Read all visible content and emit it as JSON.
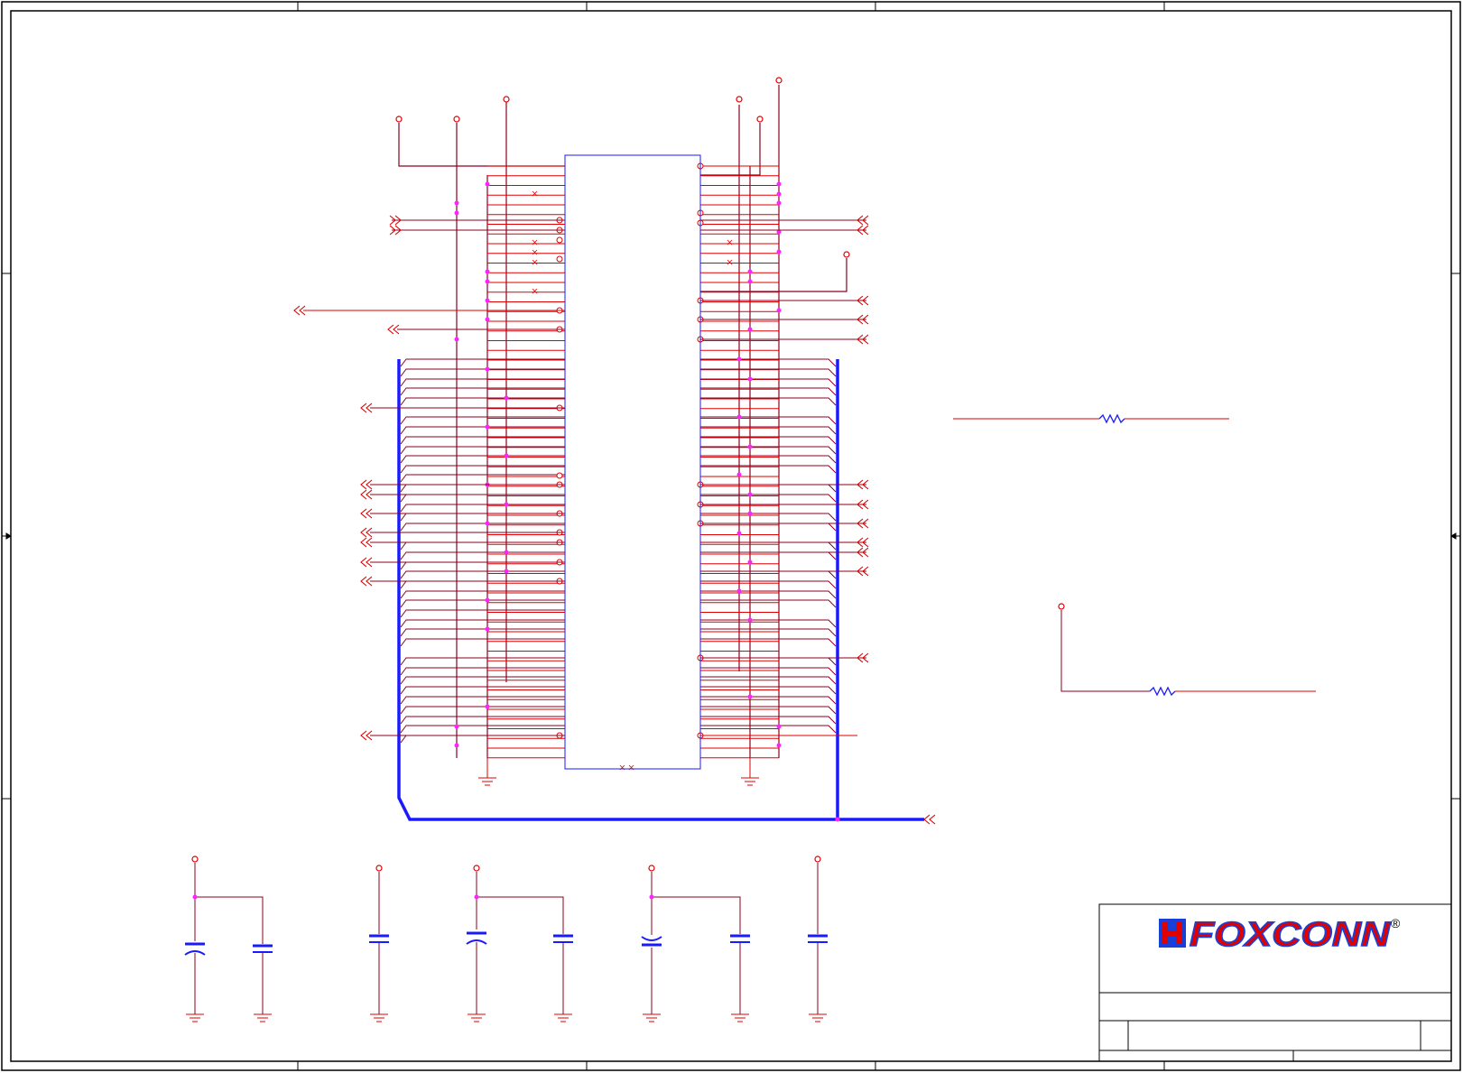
{
  "title_block": {
    "company_logo_text": "FOXCONN",
    "registered_mark": "®"
  },
  "colors": {
    "net": "#e00000",
    "bus_net": "#8b0020",
    "bus": "#1a1aff",
    "junction": "#ff22ff",
    "component_outline": "#1a1aff",
    "frame": "#000000",
    "logo_red": "#e00000",
    "logo_blue": "#1a3fd8"
  },
  "icons": {
    "power_port": "open-circle-terminal",
    "off_page_connector": "double-chevron-left",
    "ground": "ground-symbol",
    "resistor": "zigzag-resistor",
    "capacitor": "parallel-plate-capacitor",
    "polarized_capacitor": "curved-plate-capacitor",
    "no_connect": "x-mark"
  }
}
